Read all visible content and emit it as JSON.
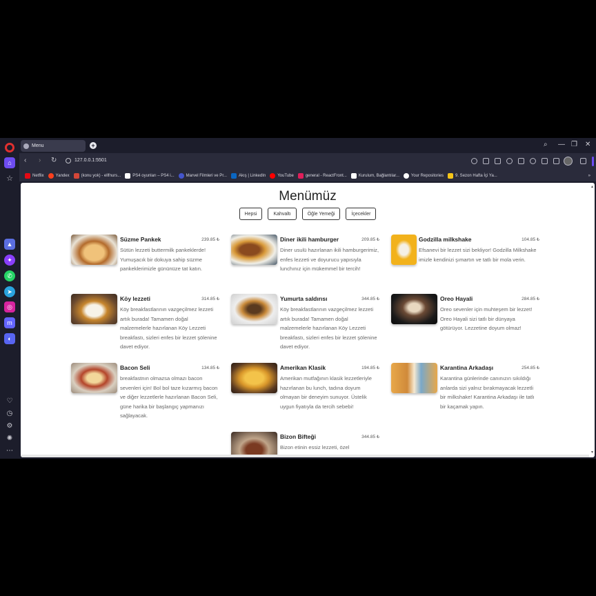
{
  "browser": {
    "tab_title": "Menu",
    "new_tab_symbol": "+",
    "url": "127.0.0.1:5501",
    "bookmarks": [
      {
        "label": "Netflix",
        "color": "#e50914"
      },
      {
        "label": "Yandex",
        "color": "#fc3f1d"
      },
      {
        "label": "(konu yok) - ellfnurs...",
        "color": "#d44638"
      },
      {
        "label": "PS4 oyunları – PS4 i...",
        "color": "#ffffff"
      },
      {
        "label": "Marvel Filmleri ve Pr...",
        "color": "#4455cc"
      },
      {
        "label": "Akış | LinkedIn",
        "color": "#0a66c2"
      },
      {
        "label": "YouTube",
        "color": "#ff0000"
      },
      {
        "label": "general - ReactFront...",
        "color": "#e01e5a"
      },
      {
        "label": "Kurulum, Bağlantılar...",
        "color": "#ffffff"
      },
      {
        "label": "Your Repositories",
        "color": "#ffffff"
      },
      {
        "label": "9. Sezon Hafta İçi Ya...",
        "color": "#f5c518"
      }
    ]
  },
  "page": {
    "title": "Menümüz",
    "filters": [
      "Hepsi",
      "Kahvaltı",
      "Öğle Yemeği",
      "İçecekler"
    ]
  },
  "menu": [
    {
      "title": "Süzme Pankek",
      "price": "239.85 ₺",
      "desc": "Sütün lezzeti buttermilk pankeklerde! Yumuşacık bir dokuya sahip süzme pankeklerimizle gününüze tat katın.",
      "thumb": "pancake"
    },
    {
      "title": "Diner ikili hamburger",
      "price": "209.85 ₺",
      "desc": "Diner usulü hazırlanan ikili hamburgerimiz, enfes lezzeti ve doyurucu yapısıyla lunchınız için mükemmel bir tercih!",
      "thumb": "burger"
    },
    {
      "title": "Godzilla milkshake",
      "price": "104.85 ₺",
      "desc": "Efsanevi bir lezzet sizi bekliyor! Godzilla Milkshake imizle kendinizi şımartın ve tatlı bir mola verin.",
      "thumb": "milkshake"
    },
    {
      "title": "Köy lezzeti",
      "price": "314.85 ₺",
      "desc": "Köy breakfastlarının vazgeçilmez lezzeti artık burada! Tamamen doğal malzemelerle hazırlanan Köy Lezzeti breakfastı, sizleri enfes bir lezzet şölenine davet ediyor.",
      "thumb": "breakfast"
    },
    {
      "title": "Yumurta saldırısı",
      "price": "344.85 ₺",
      "desc": "Köy breakfastlarının vazgeçilmez lezzeti artık burada! Tamamen doğal malzemelerle hazırlanan Köy Lezzeti breakfastı, sizleri enfes bir lezzet şölenine davet ediyor.",
      "thumb": "eggburger"
    },
    {
      "title": "Oreo Hayali",
      "price": "284.85 ₺",
      "desc": "Oreo sevenler için muhteşem bir lezzet! Oreo Hayali sizi tatlı bir dünyaya götürüyor. Lezzetine doyum olmaz!",
      "thumb": "oreo"
    },
    {
      "title": "Bacon Seli",
      "price": "134.85 ₺",
      "desc": "breakfastnın olmazsa olmazı bacon sevenleri için! Bol bol taze kızarmış bacon ve diğer lezzetlerle hazırlanan Bacon Seli, güne harika bir başlangıç yapmanızı sağlayacak.",
      "thumb": "bacon"
    },
    {
      "title": "Amerikan Klasik",
      "price": "194.85 ₺",
      "desc": "Amerikan mutfağının klasik lezzetleriyle hazırlanan bu lunch, tadına doyum olmayan bir deneyim sunuyor. Üstelik uygun fiyatıyla da tercih sebebi!",
      "thumb": "fries"
    },
    {
      "title": "Karantina Arkadaşı",
      "price": "254.85 ₺",
      "desc": "Karantina günlerinde canınızın sıkıldığı anlarda sizi yalnız bırakmayacak lezzetli bir milkshake! Karantina Arkadaşı ile tatlı bir kaçamak yapın.",
      "thumb": "couple"
    },
    {
      "title": "Bizon Bifteği",
      "price": "344.85 ₺",
      "desc": "Bizon etinin essiz lezzeti, özel",
      "thumb": "steak"
    }
  ]
}
